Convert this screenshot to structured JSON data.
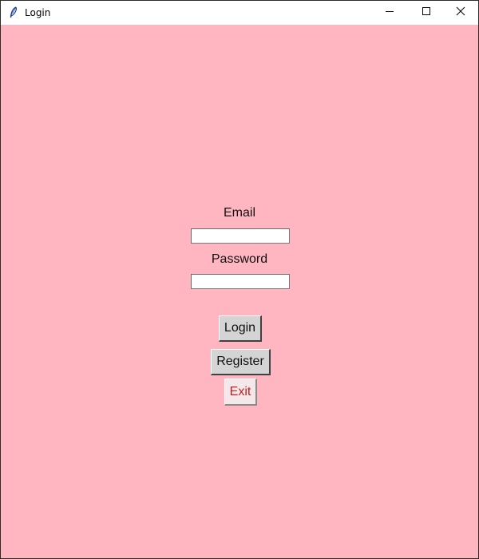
{
  "window": {
    "title": "Login",
    "background": "#ffb6c1",
    "controls": {
      "minimize_icon": "minimize-icon",
      "maximize_icon": "maximize-icon",
      "close_icon": "close-icon"
    }
  },
  "form": {
    "email_label": "Email",
    "email_value": "",
    "password_label": "Password",
    "password_value": "",
    "login_button": "Login",
    "register_button": "Register",
    "exit_button": "Exit",
    "exit_color": "#c8201e"
  }
}
